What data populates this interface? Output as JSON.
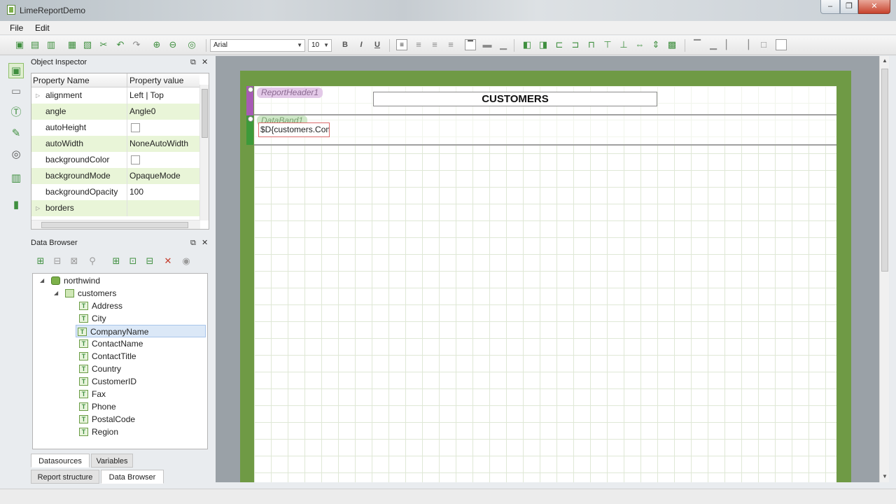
{
  "window": {
    "title": "LimeReportDemo",
    "min": "–",
    "max": "❐",
    "close": "✕"
  },
  "menu": [
    "File",
    "Edit"
  ],
  "toolbar": {
    "font_family": "Arial",
    "font_size": "10",
    "bold": "B",
    "italic": "I",
    "underline": "U"
  },
  "object_inspector": {
    "title": "Object Inspector",
    "col_name": "Property Name",
    "col_value": "Property value",
    "rows": [
      {
        "name": "alignment",
        "value": "Left | Top",
        "expandable": true
      },
      {
        "name": "angle",
        "value": "Angle0"
      },
      {
        "name": "autoHeight",
        "value": "",
        "checkbox": true
      },
      {
        "name": "autoWidth",
        "value": "NoneAutoWidth"
      },
      {
        "name": "backgroundColor",
        "value": "",
        "checkbox": true
      },
      {
        "name": "backgroundMode",
        "value": "OpaqueMode"
      },
      {
        "name": "backgroundOpacity",
        "value": "100"
      },
      {
        "name": "borders",
        "value": "",
        "expandable": true
      }
    ]
  },
  "data_browser": {
    "title": "Data Browser",
    "tree": {
      "connection": "northwind",
      "table": "customers",
      "fields": [
        "Address",
        "City",
        "CompanyName",
        "ContactName",
        "ContactTitle",
        "Country",
        "CustomerID",
        "Fax",
        "Phone",
        "PostalCode",
        "Region"
      ],
      "selected": "CompanyName"
    },
    "tabs": [
      "Datasources",
      "Variables"
    ],
    "active_tab": "Datasources"
  },
  "dock_tabs": [
    "Report structure",
    "Data Browser"
  ],
  "dock_active_tab": "Data Browser",
  "report": {
    "header_band": "ReportHeader1",
    "data_band": "DataBand1",
    "title_text": "CUSTOMERS",
    "field_text": "$D{customers.CompanyName}"
  },
  "colors": {
    "accent_green": "#6f9a45",
    "header_band": "#a75bb5",
    "data_band": "#3d9a3a"
  }
}
